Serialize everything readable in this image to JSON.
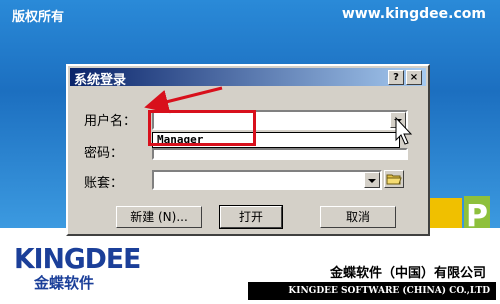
{
  "splash": {
    "copyright": "版权所有",
    "website": "www.kingdee.com",
    "p_letter": "P",
    "logo": "KINGDEE",
    "logo_cn": "金蝶软件",
    "company_cn": "金蝶软件（中国）有限公司",
    "company_en": "KINGDEE SOFTWARE (CHINA) CO.,LTD"
  },
  "dialog": {
    "title": "系统登录",
    "help_button": "?",
    "close_button": "×",
    "username_label": "用户名：",
    "username_value": "",
    "dropdown_option": "Manager",
    "password_label": "密码：",
    "account_label": "账套：",
    "buttons": {
      "new": "新建 (N)...",
      "open": "打开",
      "cancel": "取消"
    }
  },
  "colors": {
    "title_bar_start": "#0a246a",
    "highlight": "#d8101c",
    "dialog_bg": "#d4d0c8",
    "brand_blue": "#1b3f99"
  }
}
